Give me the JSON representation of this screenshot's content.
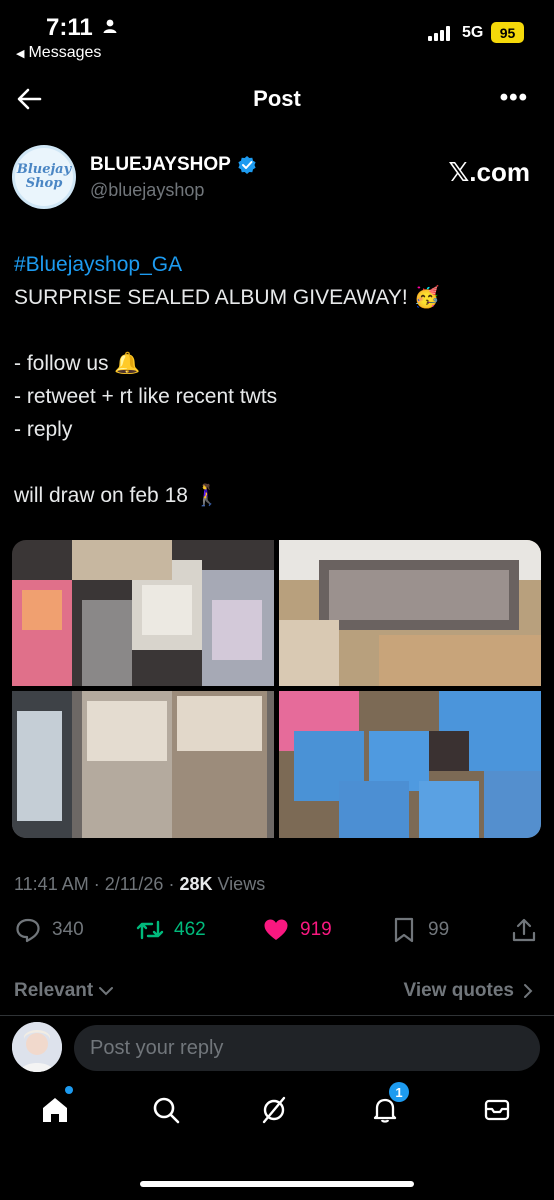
{
  "status_bar": {
    "time": "7:11",
    "back_app": "Messages",
    "network": "5G",
    "battery": "95"
  },
  "header": {
    "title": "Post"
  },
  "author": {
    "avatar_text_line1": "Bluejay",
    "avatar_text_line2": "Shop",
    "name": "BLUEJAYSHOP",
    "handle": "@bluejayshop",
    "source_label": "𝕏.com"
  },
  "tweet": {
    "hashtag": "#Bluejayshop_GA",
    "lines": [
      "SURPRISE SEALED ALBUM GIVEAWAY! 🥳",
      "",
      "- follow us 🔔",
      "- retweet + rt like recent twts",
      "- reply",
      "",
      "will draw on feb 18 🚶‍♀️"
    ]
  },
  "meta": {
    "time": "11:41 AM",
    "date": "2/11/26",
    "views_count": "28K",
    "views_label": "Views"
  },
  "actions": {
    "replies": "340",
    "retweets": "462",
    "likes": "919",
    "bookmarks": "99"
  },
  "colors": {
    "accent": "#1d9bf0",
    "retweet": "#00ba7c",
    "like": "#f91880",
    "muted": "#71767b"
  },
  "filters": {
    "sort_label": "Relevant",
    "view_quotes": "View quotes"
  },
  "reply": {
    "placeholder": "Post your reply"
  },
  "nav": {
    "notifications_badge": "1"
  }
}
